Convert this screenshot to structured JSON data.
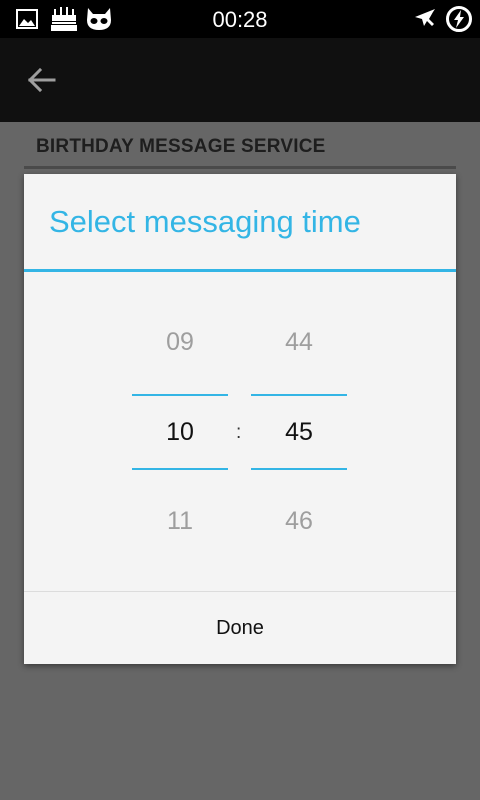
{
  "status_bar": {
    "time": "00:28",
    "left_icons": [
      "image-icon",
      "birthday-cake-icon",
      "cyanogen-mascot-icon"
    ],
    "right_icons": [
      "airplane-mode-icon",
      "battery-charging-icon"
    ]
  },
  "action_bar": {
    "back_icon": "arrow-back-icon"
  },
  "content": {
    "section_header": "BIRTHDAY MESSAGE SERVICE"
  },
  "dialog": {
    "title": "Select messaging time",
    "accent_color": "#33b5e5",
    "hour": {
      "previous": "09",
      "current": "10",
      "next": "11"
    },
    "separator": ":",
    "minute": {
      "previous": "44",
      "current": "45",
      "next": "46"
    },
    "done_label": "Done"
  }
}
